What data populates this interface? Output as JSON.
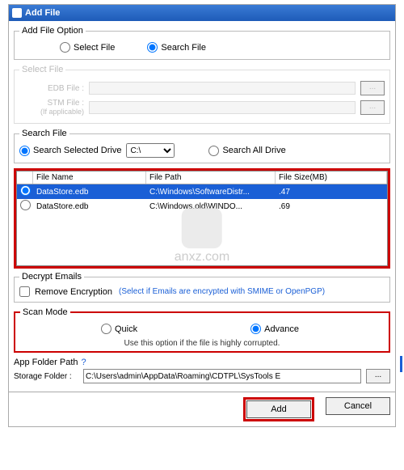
{
  "title": "Add File",
  "addFileOption": {
    "legend": "Add File Option",
    "selectFile": "Select File",
    "searchFile": "Search File",
    "selected": "searchFile"
  },
  "selectFile": {
    "legend": "Select File",
    "edbLabel": "EDB File :",
    "stmLabel": "STM File :",
    "stmNote": "(If applicable)",
    "browse": "..."
  },
  "searchFile": {
    "legend": "Search File",
    "searchSelected": "Search Selected Drive",
    "searchAll": "Search All Drive",
    "drive": "C:\\",
    "selected": "selected"
  },
  "table": {
    "headers": {
      "name": "File Name",
      "path": "File Path",
      "size": "File Size(MB)"
    },
    "rows": [
      {
        "name": "DataStore.edb",
        "path": "C:\\Windows\\SoftwareDistr...",
        "size": ".47",
        "selected": true
      },
      {
        "name": "DataStore.edb",
        "path": "C:\\Windows.old\\WINDO...",
        "size": ".69",
        "selected": false
      }
    ]
  },
  "decrypt": {
    "legend": "Decrypt Emails",
    "checkbox": "Remove Encryption",
    "hint": "(Select if Emails are encrypted with SMIME or OpenPGP)"
  },
  "scanMode": {
    "legend": "Scan Mode",
    "quick": "Quick",
    "advance": "Advance",
    "selected": "advance",
    "hint": "Use this option if the file is highly corrupted."
  },
  "appFolder": {
    "label": "App Folder Path",
    "help": "?",
    "storageLabel": "Storage Folder :",
    "storageValue": "C:\\Users\\admin\\AppData\\Roaming\\CDTPL\\SysTools E",
    "browse": "..."
  },
  "footer": {
    "add": "Add",
    "cancel": "Cancel"
  },
  "watermark": "anxz.com"
}
